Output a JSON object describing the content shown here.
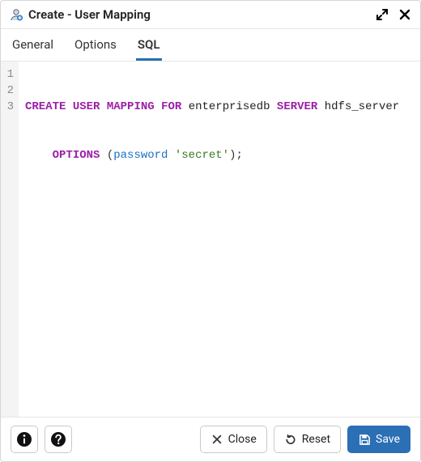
{
  "dialog": {
    "title": "Create - User Mapping"
  },
  "tabs": {
    "general": "General",
    "options": "Options",
    "sql": "SQL",
    "active": "sql"
  },
  "sql": {
    "line_numbers": [
      "1",
      "2",
      "3"
    ],
    "tokens": {
      "kw_create": "CREATE",
      "kw_user": "USER",
      "kw_mapping": "MAPPING",
      "kw_for": "FOR",
      "id_role": "enterprisedb",
      "kw_server": "SERVER",
      "id_server": "hdfs_server",
      "kw_options": "OPTIONS",
      "paren_open": "(",
      "opt_key": "password",
      "opt_val": "'secret'",
      "paren_close": ")",
      "semicolon": ";"
    },
    "indent": "    "
  },
  "footer": {
    "close": "Close",
    "reset": "Reset",
    "save": "Save"
  }
}
